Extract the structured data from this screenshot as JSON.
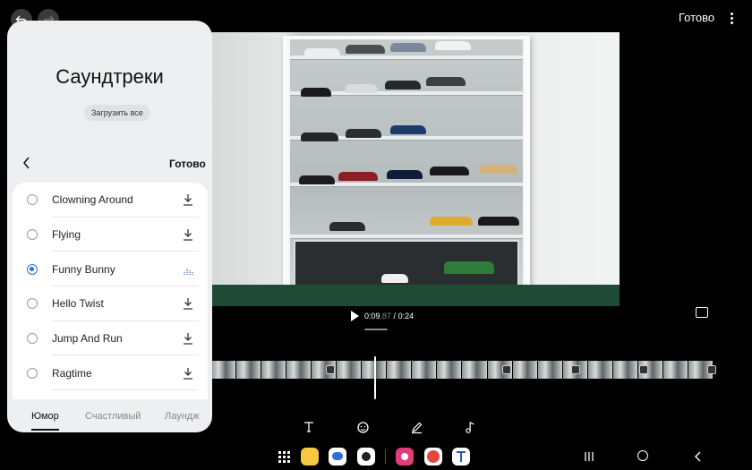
{
  "topbar": {
    "back_icon": "back-arrow-icon",
    "redo_icon": "redo-icon",
    "done_label": "Готово",
    "more_icon": "more-vertical-icon"
  },
  "playback": {
    "current_main": "0:09",
    "current_fraction": ".87",
    "separator": " / ",
    "total": "0:24"
  },
  "soundtracks": {
    "title": "Саундтреки",
    "download_all_label": "Загрузить все",
    "done_label": "Готово",
    "selected_track": "Funny Bunny",
    "tracks": [
      {
        "name": "Clowning Around",
        "state": "download"
      },
      {
        "name": "Flying",
        "state": "download"
      },
      {
        "name": "Funny Bunny",
        "state": "playing"
      },
      {
        "name": "Hello Twist",
        "state": "download"
      },
      {
        "name": "Jump And Run",
        "state": "download"
      },
      {
        "name": "Ragtime",
        "state": "download"
      }
    ],
    "tabs": [
      {
        "label": "Юмор",
        "active": true
      },
      {
        "label": "Счастливый",
        "active": false
      },
      {
        "label": "Лаундж",
        "active": false
      }
    ]
  },
  "tools": [
    "text-tool-icon",
    "sticker-tool-icon",
    "draw-tool-icon",
    "audio-tool-icon"
  ],
  "navbar": {
    "apps": [
      "app-drawer-icon",
      "notes-app-icon",
      "messages-app-icon",
      "camera-app-icon",
      "gallery-app-icon",
      "vivaldi-app-icon",
      "telegram-app-icon"
    ],
    "system": [
      "recents-icon",
      "home-icon",
      "back-icon"
    ]
  },
  "colors": {
    "accent_blue": "#2d6ddb",
    "panel_bg": "#eeeff1",
    "background": "#000000"
  }
}
